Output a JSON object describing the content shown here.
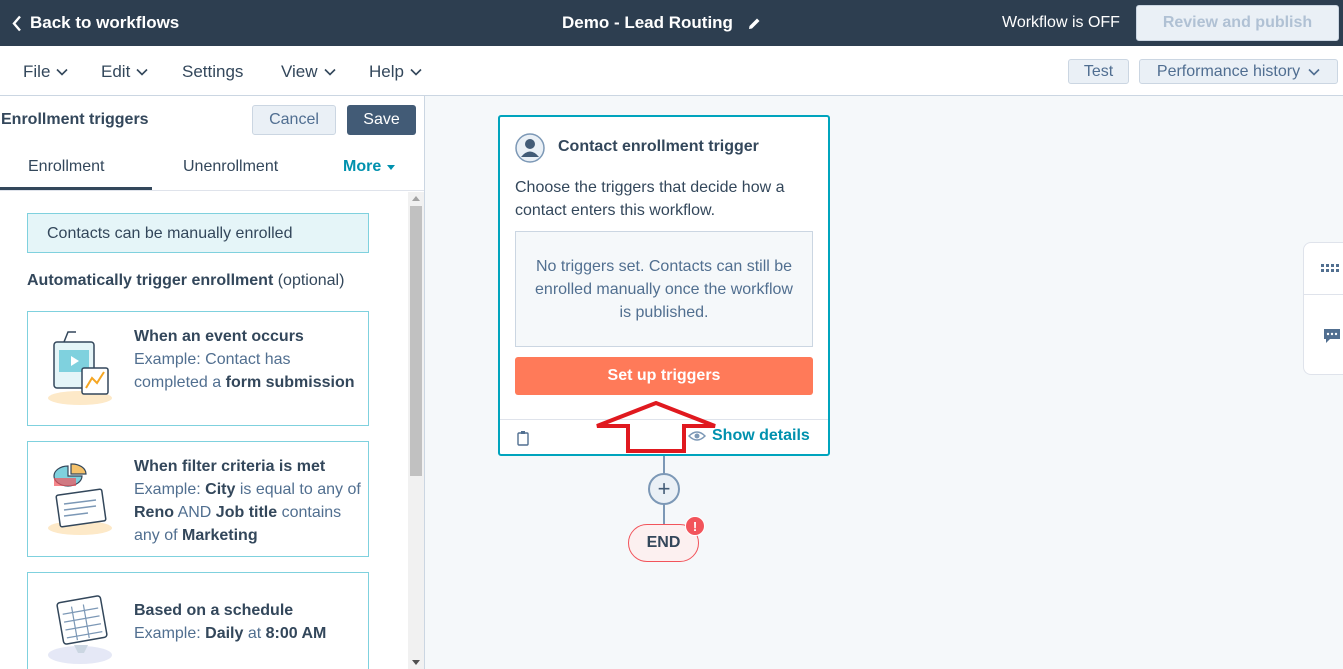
{
  "topbar": {
    "back_label": "Back to workflows",
    "workflow_name": "Demo - Lead Routing",
    "status": "Workflow is OFF",
    "review_label": "Review and publish"
  },
  "menubar": {
    "items": [
      "File",
      "Edit",
      "Settings",
      "View",
      "Help"
    ],
    "test_label": "Test",
    "performance_label": "Performance history"
  },
  "panel": {
    "title": "Enrollment triggers",
    "cancel_label": "Cancel",
    "save_label": "Save",
    "tabs": [
      "Enrollment",
      "Unenrollment",
      "More"
    ],
    "active_tab": "Enrollment",
    "manual_note": "Contacts can be manually enrolled",
    "auto_label_bold": "Automatically trigger enrollment",
    "auto_label_optional": "(optional)",
    "options": [
      {
        "title": "When an event occurs",
        "pre": "Example: Contact has completed a ",
        "b1": "form submission"
      },
      {
        "title": "When filter criteria is met",
        "pre": "Example: ",
        "b1": "City",
        "mid1": " is equal to any of ",
        "b2": "Reno",
        "mid2": " AND ",
        "b3": "Job title",
        "mid3": " contains any of ",
        "b4": "Marketing"
      },
      {
        "title": "Based on a schedule",
        "pre": "Example: ",
        "b1": "Daily",
        "mid1": " at ",
        "b2": "8:00 AM"
      }
    ]
  },
  "trigger_card": {
    "title": "Contact enrollment trigger",
    "description": "Choose the triggers that decide how a contact enters this workflow.",
    "empty_text": "No triggers set. Contacts can still be enrolled manually once the workflow is published.",
    "setup_label": "Set up triggers",
    "show_details_label": "Show details"
  },
  "flow": {
    "plus_symbol": "+",
    "end_label": "END",
    "alert_symbol": "!"
  },
  "colors": {
    "topbar": "#2d3e50",
    "accent_teal": "#00a4bd",
    "setup_orange": "#ff7a59",
    "annotation_red": "#e0191f"
  }
}
